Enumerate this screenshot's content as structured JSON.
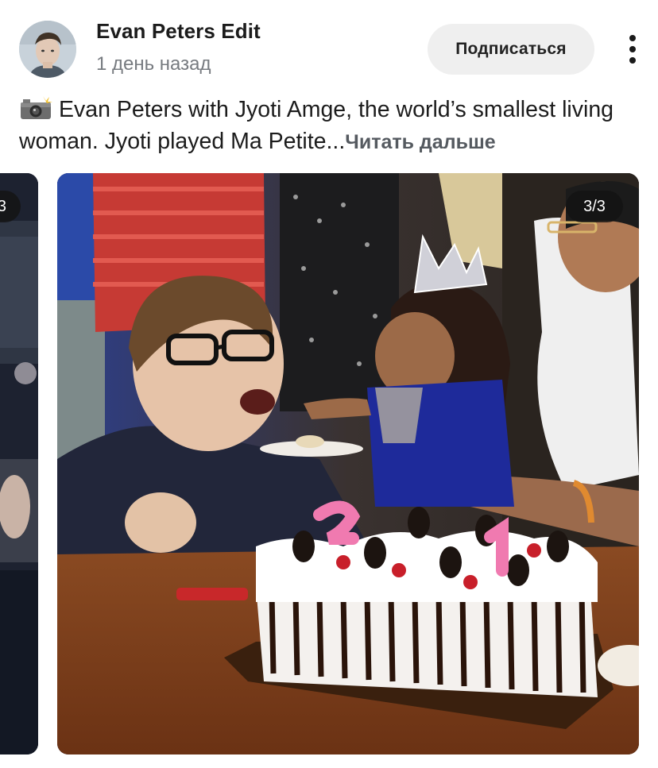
{
  "post": {
    "channel_name": "Evan Peters Edit",
    "time_ago": "1 день назад",
    "subscribe_label": "Подписаться",
    "caption_icon": "camera-flash-icon",
    "caption_text": "Evan Peters with Jyoti Amge, the world’s smallest living woman. Jyoti played Ma Petite...",
    "read_more_label": "Читать дальше"
  },
  "carousel": {
    "current_counter": "3/3",
    "prev_counter": "3",
    "photo_description": "photo"
  },
  "colors": {
    "subscribe_bg": "#efefef",
    "muted_text": "#777b80",
    "badge_bg": "#141414"
  }
}
